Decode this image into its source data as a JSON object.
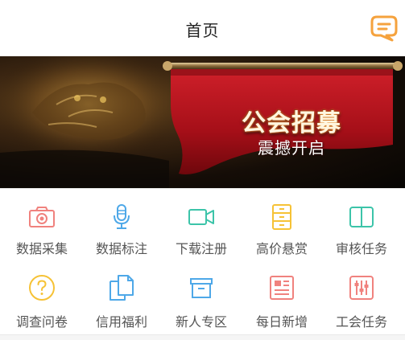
{
  "header": {
    "title": "首页",
    "message_icon": "chat-bubble-icon",
    "accent_color": "#F5A23D"
  },
  "banner": {
    "title": "公会招募",
    "subtitle": "震撼开启",
    "flag_color": "#B0101A"
  },
  "menu": {
    "items": [
      {
        "label": "数据采集",
        "icon": "camera-icon",
        "color": "#F0827E"
      },
      {
        "label": "数据标注",
        "icon": "microphone-icon",
        "color": "#4EA8E8"
      },
      {
        "label": "下载注册",
        "icon": "video-camera-icon",
        "color": "#3CC4A9"
      },
      {
        "label": "高价悬赏",
        "icon": "cabinet-icon",
        "color": "#F6C236"
      },
      {
        "label": "审核任务",
        "icon": "book-icon",
        "color": "#3CC4A9"
      },
      {
        "label": "调查问卷",
        "icon": "question-icon",
        "color": "#F6C236"
      },
      {
        "label": "信用福利",
        "icon": "documents-icon",
        "color": "#4EA8E8"
      },
      {
        "label": "新人专区",
        "icon": "box-icon",
        "color": "#4EA8E8"
      },
      {
        "label": "每日新增",
        "icon": "newspaper-icon",
        "color": "#F0827E"
      },
      {
        "label": "工会任务",
        "icon": "sliders-icon",
        "color": "#F0827E"
      }
    ]
  }
}
